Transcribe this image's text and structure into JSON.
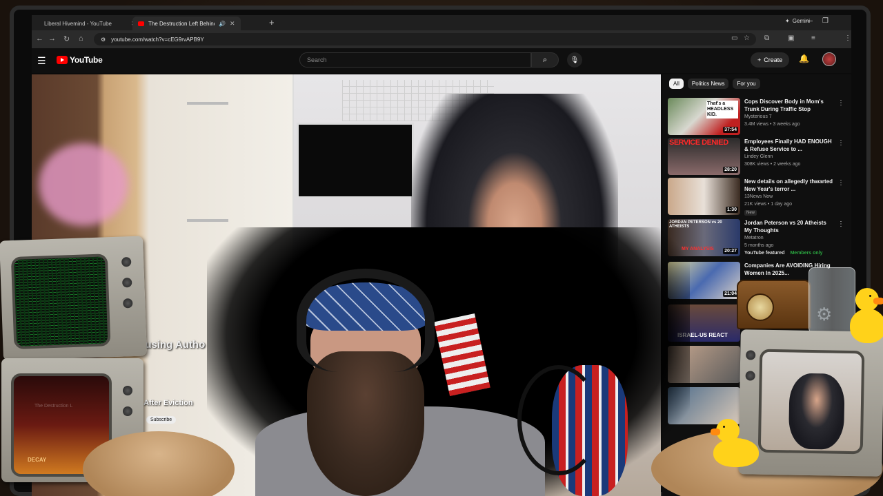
{
  "browser": {
    "tabs": [
      {
        "title": "Liberal Hivemind - YouTube",
        "active": false
      },
      {
        "title": "The Destruction Left Behind",
        "active": true
      }
    ],
    "gemini_label": "Gemini",
    "url": "youtube.com/watch?v=cEG9rvAPB9Y"
  },
  "youtube": {
    "logo_text": "YouTube",
    "search_placeholder": "Search",
    "create_label": "Create"
  },
  "video": {
    "overlay_text": "th Housing Autho",
    "overlay_text2": "After Eviction",
    "subscribe_label": "Subscribe"
  },
  "sidebar": {
    "chips": [
      "All",
      "Politics News",
      "For you"
    ],
    "recommendations": [
      {
        "title": "Cops Discover Body in Mom's Trunk During Traffic Stop",
        "channel": "Mysterious 7",
        "meta": "3.4M views • 3 weeks ago",
        "duration": "37:54",
        "thumb_text": "That's a HEADLESS KID."
      },
      {
        "title": "Employees Finally HAD ENOUGH & Refuse Service to ...",
        "channel": "Lindey Glenn",
        "meta": "308K views • 2 weeks ago",
        "duration": "28:20",
        "thumb_text": "SERVICE DENIED"
      },
      {
        "title": "New details on allegedly thwarted New Year's terror ...",
        "channel": "13News Now",
        "meta": "21K views • 1 day ago",
        "duration": "1:30",
        "badge": "New"
      },
      {
        "title": "Jordan Peterson vs 20 Atheists My Thoughts",
        "channel": "Metatron",
        "meta": "5 months ago",
        "duration": "20:27",
        "channel_note": "YouTube featured",
        "members": "Members only",
        "thumb_text": "JORDAN PETERSON vs 20 ATHEISTS",
        "thumb_sub": "MY ANALYSIS"
      },
      {
        "title": "Companies Are AVOIDING Hiring Women In 2025...",
        "duration": "21:04",
        "thumb_text": ""
      }
    ],
    "partial_thumb_text": "ISRAEL-US REACT"
  },
  "props": {
    "poster_text": "DECAY",
    "tv_faint_text": "The Destruction L"
  }
}
